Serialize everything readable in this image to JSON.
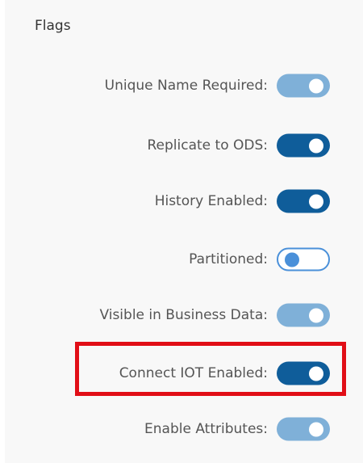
{
  "section": {
    "title": "Flags"
  },
  "colors": {
    "on_dark": "#0f5d9a",
    "on_disabled": "#7fb0d8",
    "off_border": "#4a90d9",
    "highlight": "#e10e17"
  },
  "flags": [
    {
      "label": "Unique Name Required:",
      "state": "on",
      "disabled": true
    },
    {
      "label": "Replicate to ODS:",
      "state": "on",
      "disabled": false
    },
    {
      "label": "History Enabled:",
      "state": "on",
      "disabled": false
    },
    {
      "label": "Partitioned:",
      "state": "off",
      "disabled": false
    },
    {
      "label": "Visible in Business Data:",
      "state": "on",
      "disabled": true
    },
    {
      "label": "Connect IOT Enabled:",
      "state": "on",
      "disabled": false,
      "highlighted": true
    },
    {
      "label": "Enable Attributes:",
      "state": "on",
      "disabled": true
    }
  ]
}
